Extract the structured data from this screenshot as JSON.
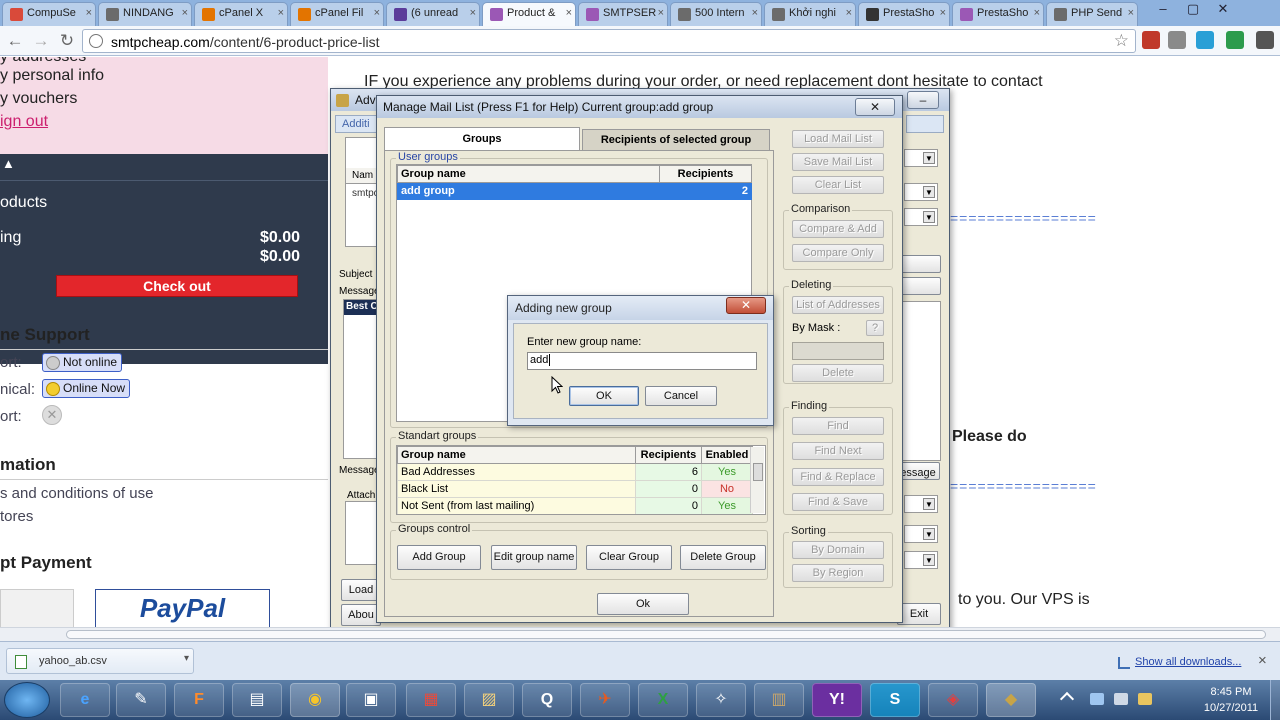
{
  "browser": {
    "tabs": [
      {
        "label": "CompuSe",
        "fav_color": "#d94a3a"
      },
      {
        "label": "NINDANG",
        "fav_color": "#6b6b6b"
      },
      {
        "label": "cPanel X",
        "fav_color": "#e37400"
      },
      {
        "label": "cPanel Fil",
        "fav_color": "#e37400"
      },
      {
        "label": "(6 unread",
        "fav_color": "#5b3c9a"
      },
      {
        "label": "Product &",
        "fav_color": "#9b58b5"
      },
      {
        "label": "SMTPSER",
        "fav_color": "#9b58b5"
      },
      {
        "label": "500 Intern",
        "fav_color": "#6b6b6b"
      },
      {
        "label": "Khởi nghi",
        "fav_color": "#6b6b6b"
      },
      {
        "label": "PrestaSho",
        "fav_color": "#333333"
      },
      {
        "label": "PrestaSho",
        "fav_color": "#9b58b5"
      },
      {
        "label": "PHP Send",
        "fav_color": "#6b6b6b"
      }
    ],
    "tab_close": "×",
    "window_controls": {
      "minimize": "–",
      "maximize": "▢",
      "close": "✕"
    },
    "nav": {
      "back": "←",
      "forward": "→",
      "reload": "↻"
    },
    "url_host": "smtpcheap.com",
    "url_path": "/content/6-product-price-list",
    "star": "☆"
  },
  "sidebar": {
    "account_links": [
      "y addresses",
      "y personal info",
      "y vouchers",
      "ign out"
    ],
    "cart_arrow": "▲",
    "cart_title": "oducts",
    "cart_rows": [
      {
        "label": "ing",
        "value": "$0.00"
      },
      {
        "label": "",
        "value": "$0.00"
      }
    ],
    "checkout": "Check out",
    "support_title": "ne Support",
    "support_rows": [
      {
        "label": "ort:",
        "status": "Not online",
        "style": "grey"
      },
      {
        "label": "nical:",
        "status": "Online Now",
        "style": "yellow"
      },
      {
        "label": "ort:",
        "status": "",
        "style": "x"
      }
    ],
    "info_title": "mation",
    "info_links": [
      "s and conditions of use",
      "tores"
    ],
    "payment_title": "pt Payment",
    "paypal": "PayPal"
  },
  "main": {
    "intro": "IF you experience any problems during your order, or need replacement dont hesitate to contact",
    "please_do": "Please do",
    "vps_text": "to you. Our VPS is",
    "dashes": "================"
  },
  "adv_window": {
    "title": "Adv",
    "tab": "Additi",
    "col_name": "Nam",
    "row1": "smtpc",
    "subject": "Subject",
    "message": "Message",
    "best": "Best C",
    "message2": "Message",
    "attach": "Attach",
    "load": "Load",
    "about": "Abou",
    "exit": "Exit",
    "message_btn": "essage",
    "minimize": "–"
  },
  "mail_list": {
    "title": "Manage Mail List  (Press F1 for Help)     Current group:add group",
    "close": "✕",
    "tabs": {
      "groups": "Groups",
      "recipients": "Recipients of selected group"
    },
    "user_groups_label": "User groups",
    "user_cols": [
      "Group name",
      "Recipients"
    ],
    "user_rows": [
      {
        "name": "add group",
        "recipients": "2"
      }
    ],
    "standard_groups_label": "Standart groups",
    "std_cols": [
      "Group name",
      "Recipients",
      "Enabled"
    ],
    "std_rows": [
      {
        "name": "Bad Addresses",
        "recipients": "6",
        "enabled": "Yes"
      },
      {
        "name": "Black List",
        "recipients": "0",
        "enabled": "No"
      },
      {
        "name": "Not Sent (from last mailing)",
        "recipients": "0",
        "enabled": "Yes"
      }
    ],
    "groups_control_label": "Groups control",
    "controls": [
      "Add Group",
      "Edit group name",
      "Clear Group",
      "Delete Group"
    ],
    "ok": "Ok",
    "right": {
      "load": "Load Mail List",
      "save": "Save Mail List",
      "clear": "Clear List",
      "comparison": "Comparison",
      "compare_add": "Compare & Add",
      "compare_only": "Compare Only",
      "deleting": "Deleting",
      "list_addr": "List of Addresses",
      "by_mask": "By Mask :",
      "mask_q": "?",
      "delete": "Delete",
      "finding": "Finding",
      "find": "Find",
      "find_next": "Find Next",
      "find_replace": "Find & Replace",
      "find_save": "Find & Save",
      "sorting": "Sorting",
      "by_domain": "By Domain",
      "by_region": "By Region"
    }
  },
  "dialog": {
    "title": "Adding new group",
    "close": "✕",
    "prompt": "Enter new group name:",
    "value": "add",
    "ok": "OK",
    "cancel": "Cancel"
  },
  "downloads": {
    "file": "yahoo_ab.csv",
    "arrow": "▾",
    "show_all": "Show all downloads...",
    "close": "×"
  },
  "taskbar": {
    "icons": [
      "e",
      "✎",
      "F",
      "▤",
      "◉",
      "▣",
      "▦",
      "▨",
      "Q",
      "✈",
      "X",
      "✧",
      "▥",
      "Y!",
      "S",
      "◈",
      "◆"
    ],
    "time": "8:45 PM",
    "date": "10/27/2011"
  },
  "colors": {
    "checkout": "#e3262b",
    "selection": "#2f7be0",
    "tab_bar": "#8eb2de",
    "taskbar": "#2b4a74"
  }
}
